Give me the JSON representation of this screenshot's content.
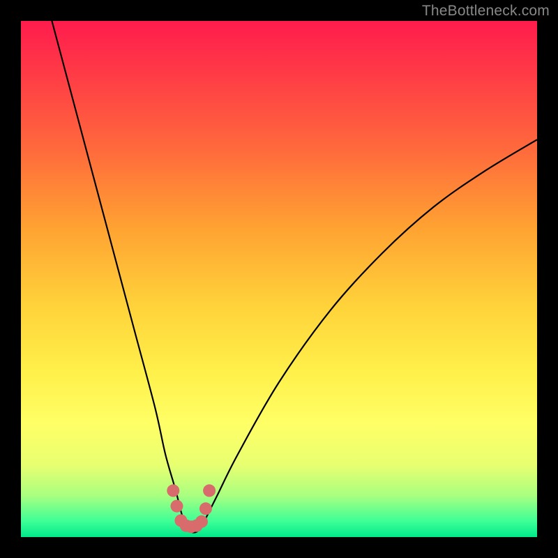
{
  "watermark": "TheBottleneck.com",
  "chart_data": {
    "type": "line",
    "title": "",
    "xlabel": "",
    "ylabel": "",
    "xlim": [
      0,
      100
    ],
    "ylim": [
      0,
      100
    ],
    "series": [
      {
        "name": "bottleneck-curve",
        "x": [
          6,
          10,
          14,
          18,
          22,
          26,
          28,
          30,
          31,
          32,
          33,
          34,
          35,
          36,
          38,
          42,
          50,
          60,
          70,
          80,
          90,
          100
        ],
        "y": [
          100,
          85,
          70,
          55,
          40,
          25,
          16,
          9,
          5,
          2,
          1,
          1,
          2,
          4,
          8,
          16,
          30,
          44,
          55,
          64,
          71,
          77
        ]
      }
    ],
    "markers": {
      "name": "highlight-dots",
      "color": "#d86b6b",
      "points_xy": [
        [
          29.5,
          9
        ],
        [
          30.2,
          6
        ],
        [
          31.0,
          3.2
        ],
        [
          32.0,
          2.2
        ],
        [
          33.0,
          2.0
        ],
        [
          34.0,
          2.2
        ],
        [
          35.0,
          3.0
        ],
        [
          35.8,
          5.5
        ],
        [
          36.5,
          9
        ]
      ]
    }
  }
}
